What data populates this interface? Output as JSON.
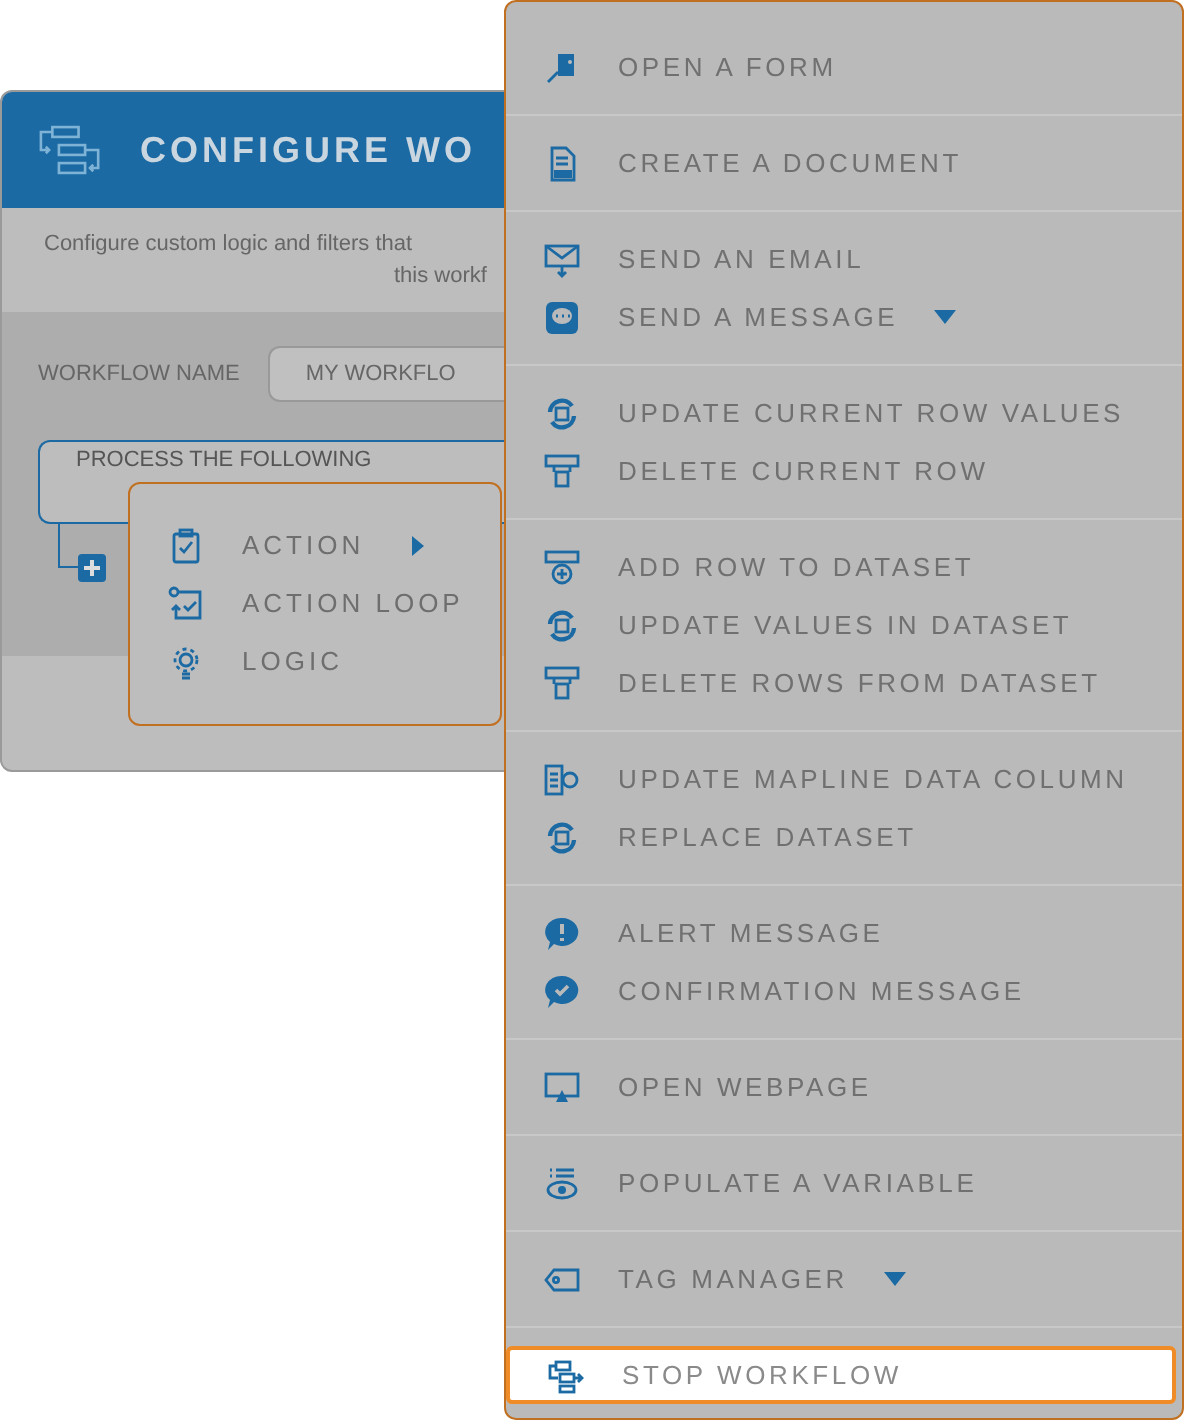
{
  "dialog": {
    "title": "CONFIGURE WO",
    "description": [
      "Configure custom logic and filters that",
      "this workf"
    ],
    "workflow_name_label": "WORKFLOW NAME",
    "workflow_name_value": "MY WORKFLO",
    "process_block": "PROCESS THE FOLLOWING"
  },
  "add_menu": [
    {
      "label": "ACTION",
      "submenu": true
    },
    {
      "label": "ACTION LOOP",
      "submenu": false
    },
    {
      "label": "LOGIC",
      "submenu": false
    }
  ],
  "action_menu": [
    [
      {
        "label": "OPEN A FORM",
        "dropdown": false,
        "selected": false
      }
    ],
    [
      {
        "label": "CREATE A DOCUMENT",
        "dropdown": false,
        "selected": false
      }
    ],
    [
      {
        "label": "SEND AN EMAIL",
        "dropdown": false,
        "selected": false
      },
      {
        "label": "SEND A MESSAGE",
        "dropdown": true,
        "selected": false
      }
    ],
    [
      {
        "label": "UPDATE CURRENT ROW VALUES",
        "dropdown": false,
        "selected": false
      },
      {
        "label": "DELETE CURRENT ROW",
        "dropdown": false,
        "selected": false
      }
    ],
    [
      {
        "label": "ADD ROW TO DATASET",
        "dropdown": false,
        "selected": false
      },
      {
        "label": "UPDATE VALUES IN DATASET",
        "dropdown": false,
        "selected": false
      },
      {
        "label": "DELETE ROWS FROM DATASET",
        "dropdown": false,
        "selected": false
      }
    ],
    [
      {
        "label": "UPDATE MAPLINE DATA COLUMN",
        "dropdown": false,
        "selected": false
      },
      {
        "label": "REPLACE DATASET",
        "dropdown": false,
        "selected": false
      }
    ],
    [
      {
        "label": "ALERT MESSAGE",
        "dropdown": false,
        "selected": false
      },
      {
        "label": "CONFIRMATION MESSAGE",
        "dropdown": false,
        "selected": false
      }
    ],
    [
      {
        "label": "OPEN WEBPAGE",
        "dropdown": false,
        "selected": false
      }
    ],
    [
      {
        "label": "POPULATE A VARIABLE",
        "dropdown": false,
        "selected": false
      }
    ],
    [
      {
        "label": "TAG MANAGER",
        "dropdown": true,
        "selected": false
      }
    ],
    [
      {
        "label": "STOP WORKFLOW",
        "dropdown": false,
        "selected": true
      }
    ]
  ]
}
